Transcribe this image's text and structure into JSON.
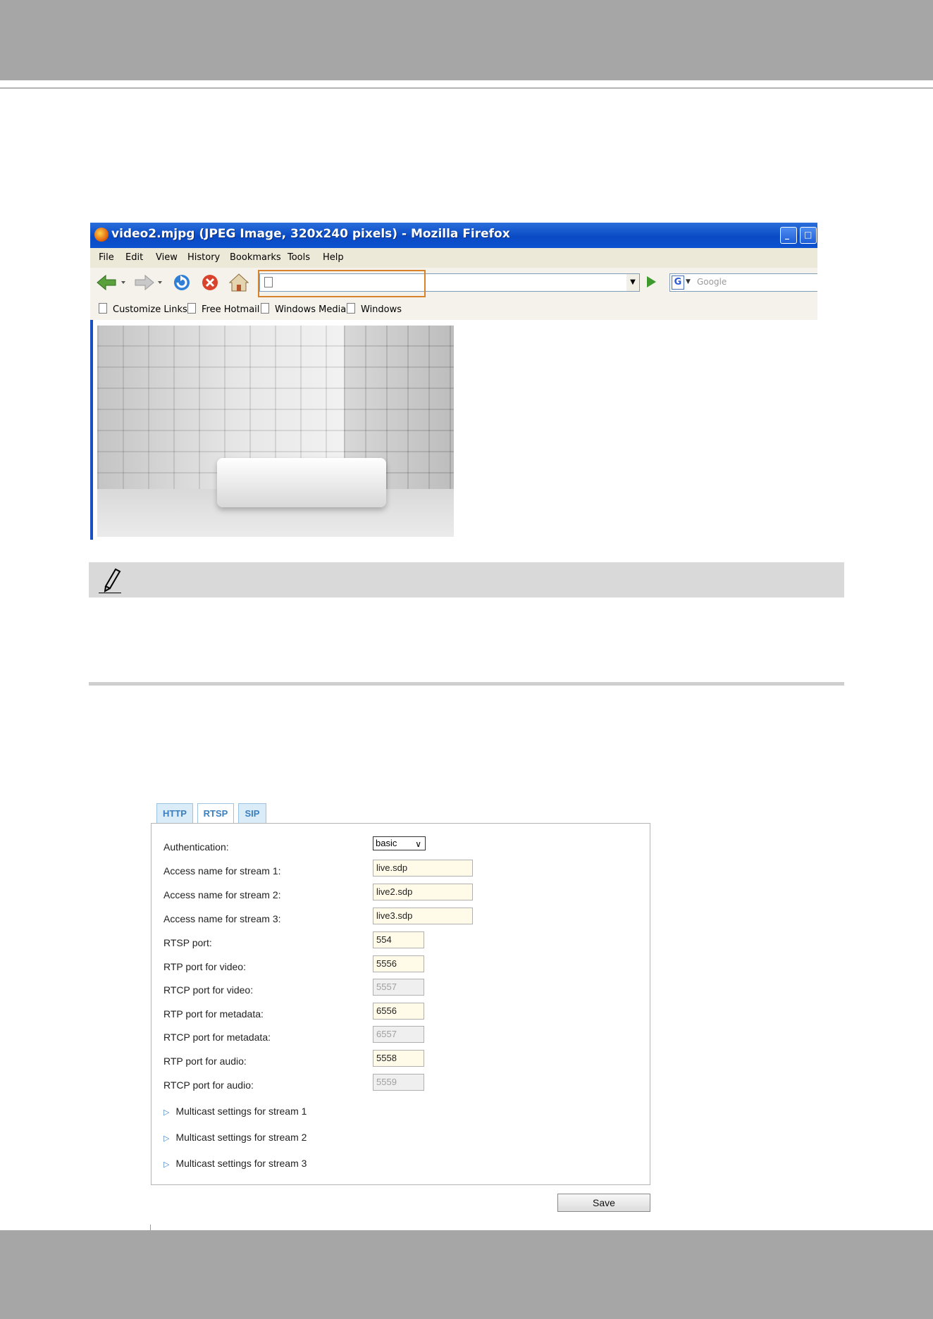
{
  "browser": {
    "window_title": "video2.mjpg (JPEG Image, 320x240 pixels) - Mozilla Firefox",
    "menu": [
      "File",
      "Edit",
      "View",
      "History",
      "Bookmarks",
      "Tools",
      "Help"
    ],
    "url_value": "",
    "search_placeholder": "Google",
    "bookmarks": [
      "Customize Links",
      "Free Hotmail",
      "Windows Media",
      "Windows"
    ]
  },
  "rtsp_panel": {
    "tabs": [
      "HTTP",
      "RTSP",
      "SIP"
    ],
    "active_tab": "RTSP",
    "authentication": {
      "label": "Authentication:",
      "value": "basic"
    },
    "fields": [
      {
        "label": "Access name for stream 1:",
        "value": "live.sdp",
        "enabled": true
      },
      {
        "label": "Access name for stream 2:",
        "value": "live2.sdp",
        "enabled": true
      },
      {
        "label": "Access name for stream 3:",
        "value": "live3.sdp",
        "enabled": true
      },
      {
        "label": "RTSP port:",
        "value": "554",
        "enabled": true
      },
      {
        "label": "RTP port for video:",
        "value": "5556",
        "enabled": true
      },
      {
        "label": "RTCP port for video:",
        "value": "5557",
        "enabled": false
      },
      {
        "label": "RTP port for metadata:",
        "value": "6556",
        "enabled": true
      },
      {
        "label": "RTCP port for metadata:",
        "value": "6557",
        "enabled": false
      },
      {
        "label": "RTP port for audio:",
        "value": "5558",
        "enabled": true
      },
      {
        "label": "RTCP port for audio:",
        "value": "5559",
        "enabled": false
      }
    ],
    "multicast": [
      "Multicast settings for stream 1",
      "Multicast settings for stream 2",
      "Multicast settings for stream 3"
    ],
    "save_label": "Save"
  }
}
